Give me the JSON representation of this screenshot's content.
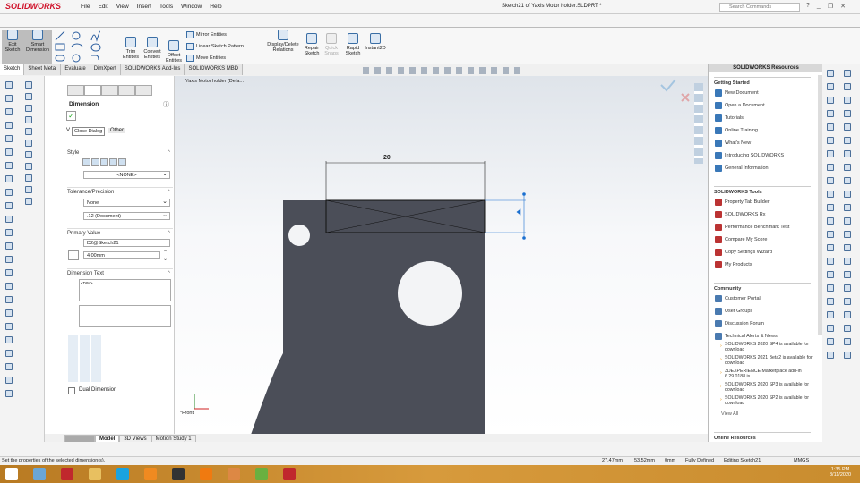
{
  "app": {
    "logo": "SOLIDWORKS",
    "title": "Sketch21 of Yaxis Motor holder.SLDPRT *",
    "search_placeholder": "Search Commands"
  },
  "menu": [
    "File",
    "Edit",
    "View",
    "Insert",
    "Tools",
    "Window",
    "Help"
  ],
  "ribbon": {
    "exit_sketch": "Exit Sketch",
    "smart_dimension": "Smart Dimension",
    "trim": "Trim Entities",
    "convert": "Convert Entities",
    "offset": "Offset Entities",
    "mirror": "Mirror Entities",
    "linear_pattern": "Linear Sketch Pattern",
    "move": "Move Entities",
    "relations": "Display/Delete Relations",
    "repair": "Repair Sketch",
    "quick_snaps": "Quick Snaps",
    "rapid": "Rapid Sketch",
    "instant2d": "Instant2D"
  },
  "cm_tabs": [
    "Sketch",
    "Sheet Metal",
    "Evaluate",
    "DimXpert",
    "SOLIDWORKS Add-Ins",
    "SOLIDWORKS MBD"
  ],
  "pm": {
    "title": "Dimension",
    "tooltip": "Close Dialog",
    "tab_value": "V",
    "tab_other": "Other",
    "style": "Style",
    "style_value": "<NONE>",
    "tolerance": "Tolerance/Precision",
    "tol_value": "None",
    "precision_value": ".12 (Document)",
    "primary": "Primary Value",
    "primary_name": "D2@Sketch21",
    "primary_value": "4.00mm",
    "dim_text": "Dimension Text",
    "dim_text_value": "<DIM>",
    "dual": "Dual Dimension"
  },
  "graphics": {
    "tree_item": "Yaxis Motor holder (Defa...",
    "dimension": "20",
    "view_label": "*Front",
    "part_color": "#4b4e58",
    "selection_color": "#1a6fd0"
  },
  "resources": {
    "title": "SOLIDWORKS Resources",
    "getting_started": {
      "title": "Getting Started",
      "items": [
        "New Document",
        "Open a Document",
        "Tutorials",
        "Online Training",
        "What's New",
        "Introducing SOLIDWORKS",
        "General Information"
      ]
    },
    "tools": {
      "title": "SOLIDWORKS Tools",
      "items": [
        "Property Tab Builder",
        "SOLIDWORKS Rx",
        "Performance Benchmark Test",
        "Compare My Score",
        "Copy Settings Wizard",
        "My Products"
      ]
    },
    "community": {
      "title": "Community",
      "items": [
        "Customer Portal",
        "User Groups",
        "Discussion Forum",
        "Technical Alerts & News"
      ],
      "news": [
        "SOLIDWORKS 2020 SP4 is available for download",
        "SOLIDWORKS 2021 Beta2 is available for download",
        "3DEXPERIENCE Marketplace add-in 6.29.0188 is ...",
        "SOLIDWORKS 2020 SP3 is available for download",
        "SOLIDWORKS 2020 SP2 is available for download"
      ],
      "view_all": "View All"
    },
    "online": "Online Resources"
  },
  "bottom_tabs": [
    "Model",
    "3D Views",
    "Motion Study 1"
  ],
  "status": {
    "message": "Set the properties of the selected dimension(s).",
    "x": "27.47mm",
    "y": "53.52mm",
    "z": "0mm",
    "state": "Fully Defined",
    "editing": "Editing Sketch21",
    "units": "MMGS"
  },
  "clock": {
    "time": "1:35 PM",
    "date": "8/11/2020"
  }
}
